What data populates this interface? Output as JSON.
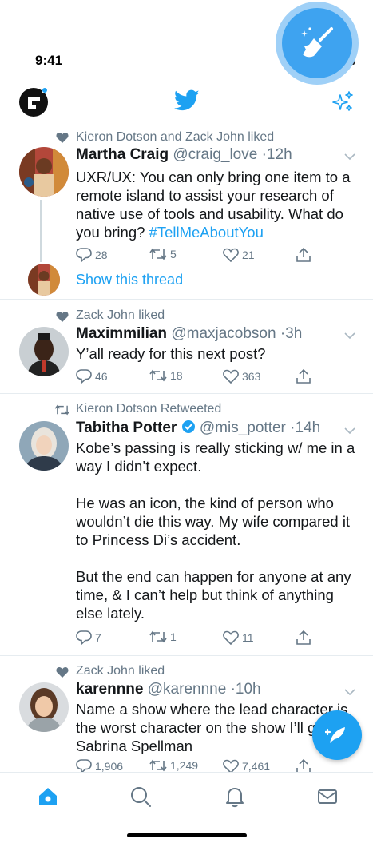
{
  "status_bar": {
    "time": "9:41"
  },
  "colors": {
    "accent": "#1da1f2",
    "secondary_text": "#657786",
    "divider": "#e6ecf0"
  },
  "nav": {
    "avatar_icon": "profile-logo-icon",
    "center_icon": "twitter-bird-icon",
    "right_icon": "sparkle-icon"
  },
  "tweets": [
    {
      "social_context": "Kieron Dotson and Zack John liked",
      "social_icon": "heart-icon",
      "name": "Martha Craig",
      "handle": "@craig_love",
      "time": "·12h",
      "text": "UXR/UX: You can only bring one item to a remote island to assist your research of native use of tools and usability. What do you bring?",
      "hashtag": "#TellMeAboutYou",
      "replies": "28",
      "retweets": "5",
      "likes": "21",
      "show_thread": "Show this thread"
    },
    {
      "social_context": "Zack John liked",
      "social_icon": "heart-icon",
      "name": "Maximmilian",
      "handle": "@maxjacobson",
      "time": "·3h",
      "text": "Y’all ready for this next post?",
      "replies": "46",
      "retweets": "18",
      "likes": "363"
    },
    {
      "social_context": "Kieron Dotson Retweeted",
      "social_icon": "retweet-icon",
      "name": "Tabitha Potter",
      "verified": true,
      "handle": "@mis_potter",
      "time": "·14h",
      "text_lines": [
        "Kobe’s passing is really sticking w/ me in a",
        "way I didn’t expect.",
        "",
        "He was an icon, the kind of person who",
        "wouldn’t die this way. My wife compared it",
        "to Princess Di’s accident.",
        "",
        "But the end can happen for anyone at any",
        "time, & I can’t help but think of anything",
        "else lately."
      ],
      "replies": "7",
      "retweets": "1",
      "likes": "11"
    },
    {
      "social_context": "Zack John liked",
      "social_icon": "heart-icon",
      "name": "karennne",
      "handle": "@karennne",
      "time": "·10h",
      "text_lines": [
        "Name a show where the lead character is",
        "the worst character on the show I’ll g",
        "Sabrina Spellman"
      ],
      "replies": "1,906",
      "retweets": "1,249",
      "likes": "7,461"
    }
  ],
  "tabs": [
    {
      "name": "home",
      "icon": "home-icon",
      "active": true
    },
    {
      "name": "search",
      "icon": "search-icon",
      "active": false
    },
    {
      "name": "notifications",
      "icon": "bell-icon",
      "active": false
    },
    {
      "name": "messages",
      "icon": "mail-icon",
      "active": false
    }
  ],
  "compose_icon": "compose-feather-icon",
  "clean_icon": "broom-sparkle-icon"
}
